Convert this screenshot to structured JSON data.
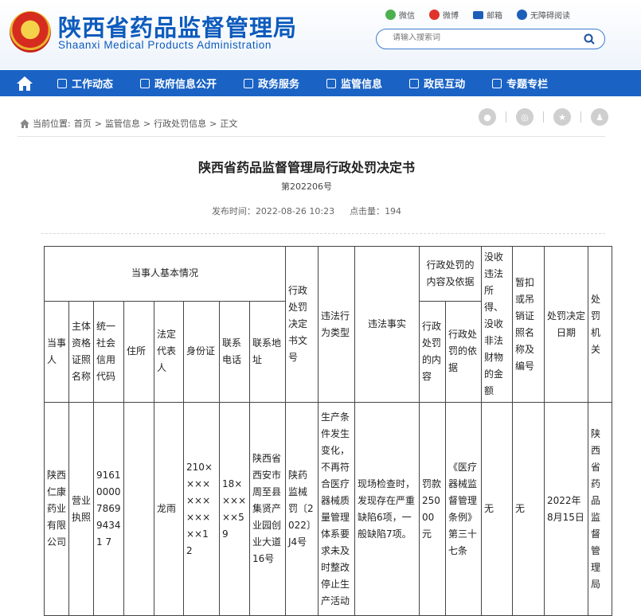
{
  "header": {
    "emblem_alt": "陕西省",
    "title_cn": "陕西省药品监督管理局",
    "title_en": "Shaanxi Medical Products Administration",
    "links": [
      {
        "label": "微信",
        "icon": "wechat-icon"
      },
      {
        "label": "微博",
        "icon": "weibo-icon"
      },
      {
        "label": "邮箱",
        "icon": "mail-icon"
      },
      {
        "label": "无障碍阅读",
        "icon": "accessibility-icon"
      }
    ],
    "search_placeholder": "请输入搜索词"
  },
  "nav": {
    "items": [
      "工作动态",
      "政府信息公开",
      "政务服务",
      "监管信息",
      "政民互动",
      "专题专栏"
    ]
  },
  "breadcrumb": {
    "prefix": "当前位置:",
    "items": [
      "首页",
      "监管信息",
      "行政处罚信息",
      "正文"
    ],
    "separator": ">"
  },
  "article": {
    "title": "陕西省药品监督管理局行政处罚决定书",
    "doc_no": "第202206号",
    "publish_label": "发布时间：",
    "publish_time": "2022-08-26 10:23",
    "clicks_label": "点击量：",
    "clicks": "194"
  },
  "table": {
    "header_group_party": "当事人基本情况",
    "header_group_penalty": "行政处罚的内容及依据",
    "headers": {
      "party": "当事人",
      "license": "主体资格证照名称",
      "credit_code": "统一社会信用代码",
      "address": "住所",
      "legal_rep": "法定代表人",
      "id_card": "身份证",
      "phone": "联系电话",
      "contact_addr": "联系地址",
      "decision_no": "行政处罚决定书文号",
      "violation_type": "违法行为类型",
      "facts": "违法事实",
      "penalty_content": "行政处罚的内容",
      "penalty_basis": "行政处罚的依据",
      "confiscation": "没收违法所得、没收非法财物的金额",
      "suspend": "暂扣或吊销证照名称及编号",
      "date": "处罚决定日期",
      "authority": "处罚机关"
    },
    "row": {
      "party": "陕西仁康药业有限公司",
      "license": "营业执照",
      "credit_code": "91610000786994341 7",
      "address": "",
      "legal_rep": "龙雨",
      "id_card": "210××××××××××××1 2",
      "phone": "18××××××59",
      "contact_addr": "陕西省西安市周至县集贤产业园创业大道16号",
      "decision_no": "陕药监械罚〔2022〕J4号",
      "violation_type": "生产条件发生变化，不再符合医疗器械质量管理体系要求未及时整改停止生产活动",
      "facts": "现场检查时，发现存在严重缺陷6项，一般缺陷7项。",
      "penalty_content": "罚款25000元",
      "penalty_basis": "《医疗器械监督管理条例》第三十七条",
      "confiscation": "无",
      "suspend": "无",
      "date": "2022年8月15日",
      "authority": "陕西省药品监督管理局"
    }
  }
}
